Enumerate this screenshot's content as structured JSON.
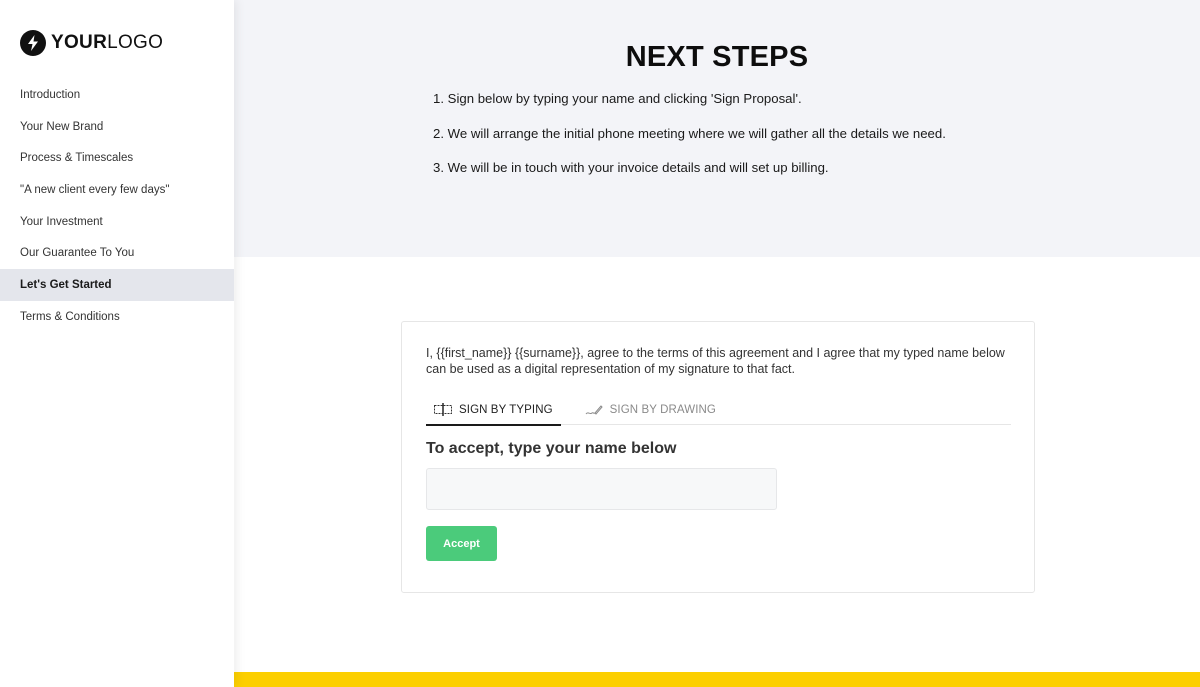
{
  "brand": {
    "logo_bold": "YOUR",
    "logo_light": "LOGO",
    "logo_icon": "lightning-bolt-icon"
  },
  "sidebar": {
    "items": [
      {
        "label": "Introduction",
        "active": false
      },
      {
        "label": "Your New Brand",
        "active": false
      },
      {
        "label": "Process & Timescales",
        "active": false
      },
      {
        "label": "\"A new client every few days\"",
        "active": false
      },
      {
        "label": "Your Investment",
        "active": false
      },
      {
        "label": "Our Guarantee To You",
        "active": false
      },
      {
        "label": "Let's Get Started",
        "active": true
      },
      {
        "label": "Terms & Conditions",
        "active": false
      }
    ]
  },
  "hero": {
    "title": "NEXT STEPS",
    "steps": [
      "1. Sign below by typing your name and clicking 'Sign Proposal'.",
      "2. We will arrange the initial phone meeting where we will gather all the details we need.",
      "3. We will be in touch with your invoice details and will set up billing."
    ]
  },
  "signature": {
    "agreement_text": "I, {{first_name}} {{surname}}, agree to the terms of this agreement and I agree that my typed name below can be used as a digital representation of my signature to that fact.",
    "tabs": [
      {
        "label": "SIGN BY TYPING",
        "icon": "text-cursor-icon",
        "active": true
      },
      {
        "label": "SIGN BY DRAWING",
        "icon": "pen-icon",
        "active": false
      }
    ],
    "input_label": "To accept, type your name below",
    "input_value": "",
    "input_placeholder": "",
    "accept_button": "Accept"
  },
  "colors": {
    "accent_yellow": "#fccf00",
    "accept_green": "#4bcb7b",
    "hero_bg": "#f3f4f8",
    "active_nav_bg": "#e4e6ec"
  }
}
